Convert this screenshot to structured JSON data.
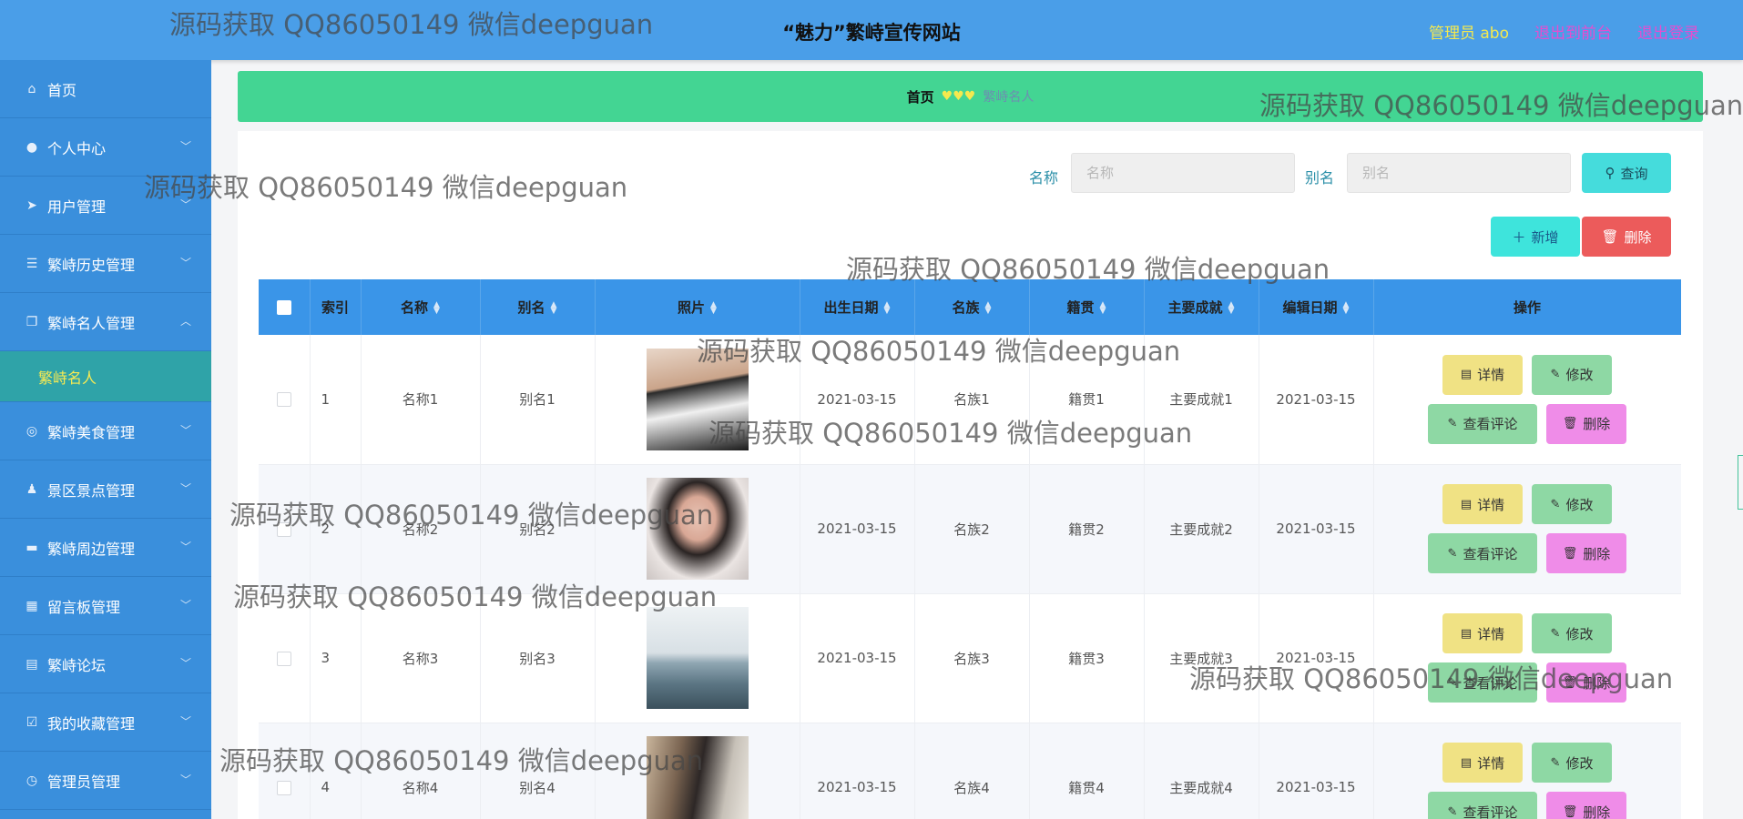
{
  "header": {
    "title": "“魅力”繁峙宣传网站",
    "admin": "管理员 abo",
    "to_front": "退出到前台",
    "logout": "退出登录"
  },
  "sidebar": {
    "items": [
      {
        "label": "首页",
        "icon": "home-icon",
        "chevron": false
      },
      {
        "label": "个人中心",
        "icon": "user-icon",
        "chevron": true
      },
      {
        "label": "用户管理",
        "icon": "send-icon",
        "chevron": true
      },
      {
        "label": "繁峙历史管理",
        "icon": "list-icon",
        "chevron": true
      },
      {
        "label": "繁峙名人管理",
        "icon": "copy-icon",
        "chevron": true,
        "expanded": true
      },
      {
        "label": "繁峙美食管理",
        "icon": "compass-icon",
        "chevron": true
      },
      {
        "label": "景区景点管理",
        "icon": "person-icon",
        "chevron": true
      },
      {
        "label": "繁峙周边管理",
        "icon": "box-icon",
        "chevron": true
      },
      {
        "label": "留言板管理",
        "icon": "grid-icon",
        "chevron": true
      },
      {
        "label": "繁峙论坛",
        "icon": "doc-icon",
        "chevron": true
      },
      {
        "label": "我的收藏管理",
        "icon": "check-icon",
        "chevron": true
      },
      {
        "label": "管理员管理",
        "icon": "clock-icon",
        "chevron": true
      }
    ],
    "sub_item": "繁峙名人"
  },
  "breadcrumb": {
    "home": "首页",
    "current": "繁峙名人"
  },
  "search": {
    "name_label": "名称",
    "name_placeholder": "名称",
    "alias_label": "别名",
    "alias_placeholder": "别名",
    "query_button": "查询"
  },
  "actions": {
    "add": "新增",
    "delete": "删除"
  },
  "table": {
    "columns": [
      "索引",
      "名称",
      "别名",
      "照片",
      "出生日期",
      "名族",
      "籍贯",
      "主要成就",
      "编辑日期",
      "操作"
    ],
    "rows": [
      {
        "index": "1",
        "name": "名称1",
        "alias": "别名1",
        "birth": "2021-03-15",
        "ethnicity": "名族1",
        "native": "籍贯1",
        "achievement": "主要成就1",
        "edited": "2021-03-15"
      },
      {
        "index": "2",
        "name": "名称2",
        "alias": "别名2",
        "birth": "2021-03-15",
        "ethnicity": "名族2",
        "native": "籍贯2",
        "achievement": "主要成就2",
        "edited": "2021-03-15"
      },
      {
        "index": "3",
        "name": "名称3",
        "alias": "别名3",
        "birth": "2021-03-15",
        "ethnicity": "名族3",
        "native": "籍贯3",
        "achievement": "主要成就3",
        "edited": "2021-03-15"
      },
      {
        "index": "4",
        "name": "名称4",
        "alias": "别名4",
        "birth": "2021-03-15",
        "ethnicity": "名族4",
        "native": "籍贯4",
        "achievement": "主要成就4",
        "edited": "2021-03-15"
      }
    ],
    "ops": {
      "detail": "详情",
      "edit": "修改",
      "comments": "查看评论",
      "delete": "删除"
    }
  },
  "watermark": "源码获取 QQ86050149 微信deepguan",
  "colors": {
    "header": "#4a9ee8",
    "sidebar": "#3a8fdc",
    "breadcrumb": "#43d593",
    "table_header": "#3a95e8",
    "admin_text": "#f5e94e",
    "header_links": "#e84ccf"
  }
}
